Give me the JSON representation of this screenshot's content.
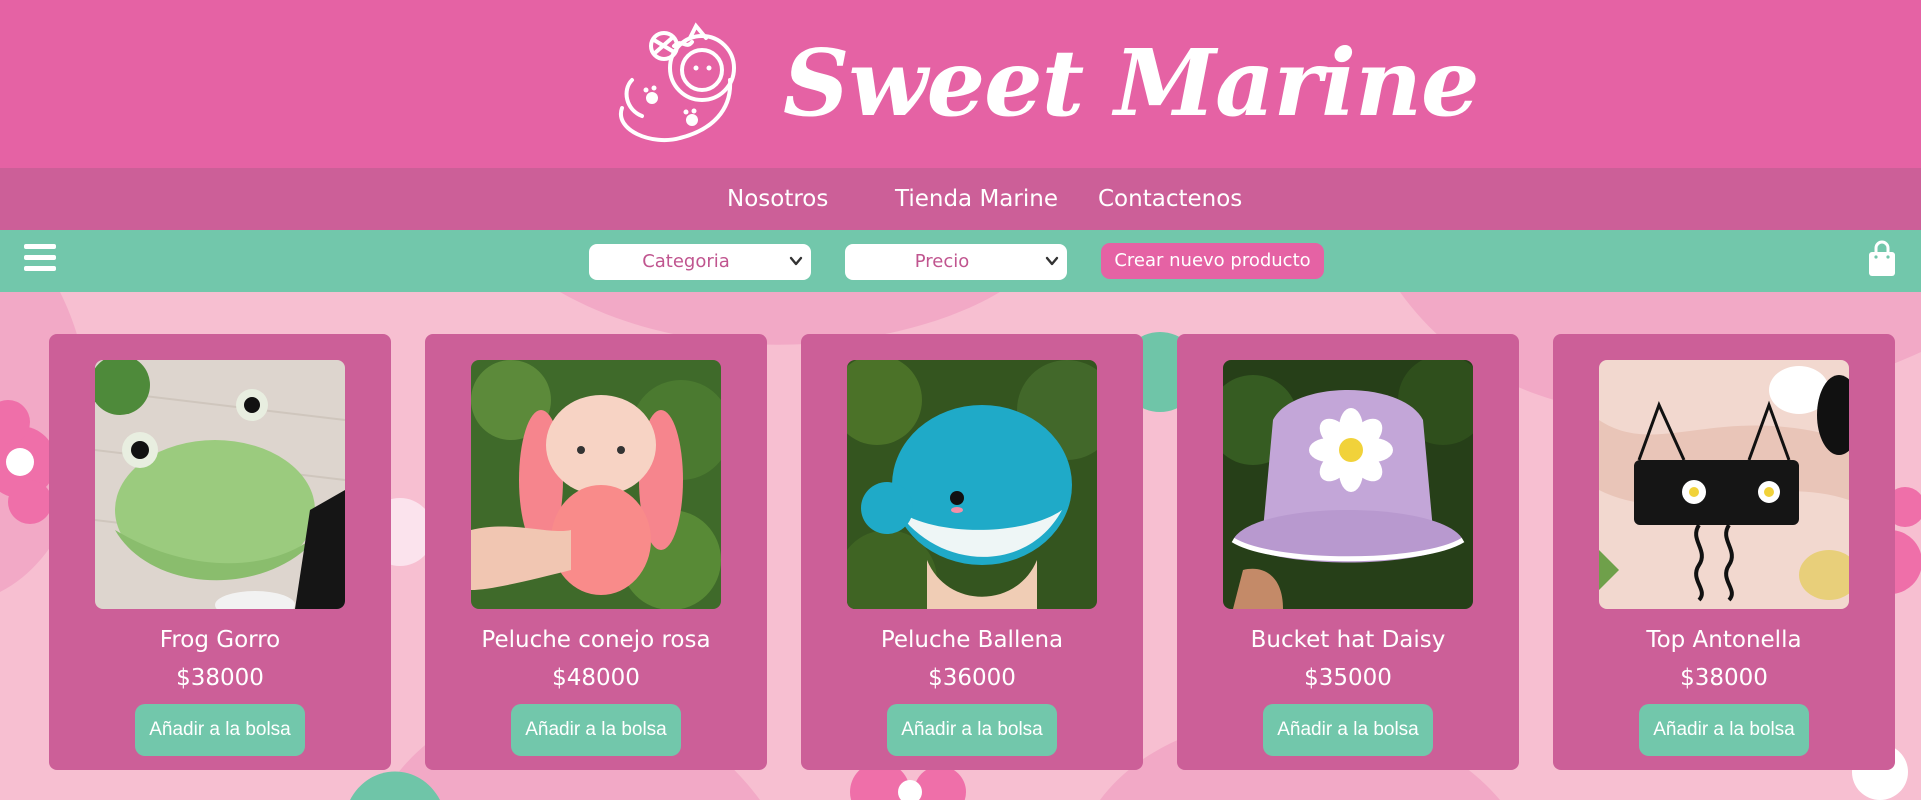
{
  "header": {
    "logo_icon": "cat-astronaut-logo-icon",
    "brand": "Sweet Marine"
  },
  "nav": {
    "links": [
      "Nosotros",
      "Tienda Marine",
      "Contactenos"
    ]
  },
  "toolbar": {
    "menu_icon": "hamburger-menu-icon",
    "category_select": {
      "selected": "Categoria"
    },
    "price_select": {
      "selected": "Precio"
    },
    "create_button": "Crear nuevo producto",
    "bag_icon": "shopping-bag-icon"
  },
  "products": [
    {
      "title": "Frog Gorro",
      "price": "$38000",
      "button": "Añadir a la bolsa",
      "image": "green frog crochet bucket hat"
    },
    {
      "title": "Peluche conejo rosa",
      "price": "$48000",
      "button": "Añadir a la bolsa",
      "image": "pink crochet bunny plush"
    },
    {
      "title": "Peluche Ballena",
      "price": "$36000",
      "button": "Añadir a la bolsa",
      "image": "blue crochet whale plush"
    },
    {
      "title": "Bucket hat Daisy",
      "price": "$35000",
      "button": "Añadir a la bolsa",
      "image": "lilac crochet bucket hat with daisy"
    },
    {
      "title": "Top Antonella",
      "price": "$38000",
      "button": "Añadir a la bolsa",
      "image": "black crochet top with daisies"
    }
  ],
  "colors": {
    "header": "#e562a4",
    "nav": "#cc5f98",
    "toolbar": "#72c7ab",
    "card": "#cc5f98",
    "button": "#72c7ab",
    "background": "#f7bfd1"
  }
}
